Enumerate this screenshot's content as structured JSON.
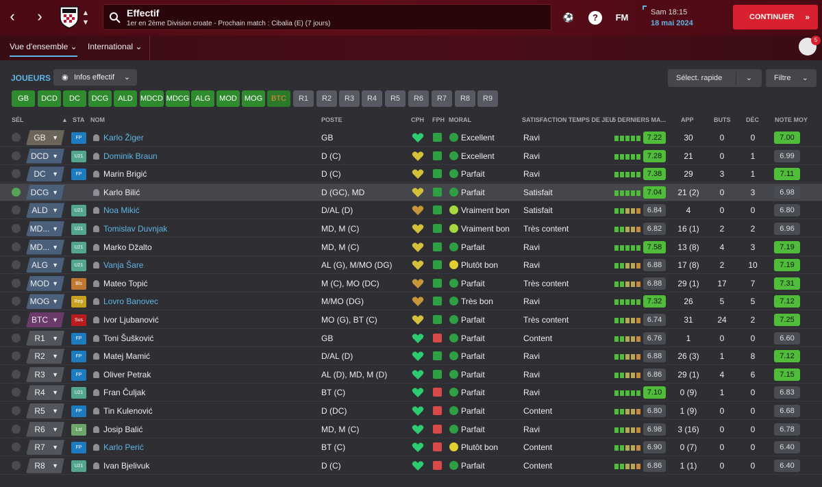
{
  "header": {
    "title": "Effectif",
    "subtitle": "1er en 2ème Division croate - Prochain match : Cibalia (E) (7 jours)",
    "fm_label": "FM",
    "time": "Sam 18:15",
    "date": "18 mai 2024",
    "continue_label": "CONTINUER",
    "inbox_count": "5"
  },
  "tabs": {
    "overview": "Vue d'ensemble",
    "international": "International"
  },
  "toolbar": {
    "players_label": "JOUEURS",
    "view_label": "Infos effectif",
    "quick_select": "Sélect. rapide",
    "filter": "Filtre"
  },
  "chips": [
    "GB",
    "DCD",
    "DC",
    "DCG",
    "ALD",
    "MDCD",
    "MDCG",
    "ALG",
    "MOD",
    "MOG",
    "BTC",
    "R1",
    "R2",
    "R3",
    "R4",
    "R5",
    "R6",
    "R7",
    "R8",
    "R9"
  ],
  "columns": {
    "sel": "SÉL",
    "sta": "STA",
    "name": "NOM",
    "pos": "POSTE",
    "cph": "CPH",
    "fph": "FPH",
    "moral": "MORAL",
    "sat": "SATISFACTION TEMPS DE JEU",
    "form": "5 DERNIERS MA...",
    "app": "APP",
    "buts": "BUTS",
    "dec": "DÉC",
    "note": "NOTE MOY"
  },
  "colors": {
    "accent": "#5fb5e6",
    "continue": "#d8202e",
    "good_rating": "#4fbd3a",
    "chip_green": "#2e8b2e",
    "chip_grey": "#575a62"
  },
  "players": [
    {
      "slot": "GB",
      "sta": "FP",
      "name": "Karlo Žiger",
      "pos": "GB",
      "moral": "Excellent",
      "sat": "Ravi",
      "form": "7.22",
      "app": "30",
      "buts": "0",
      "dec": "0",
      "note": "7.00"
    },
    {
      "slot": "DCD",
      "sta": "U21",
      "name": "Dominik Braun",
      "pos": "D (C)",
      "moral": "Excellent",
      "sat": "Ravi",
      "form": "7.28",
      "app": "21",
      "buts": "0",
      "dec": "1",
      "note": "6.99"
    },
    {
      "slot": "DC",
      "sta": "FP",
      "name": "Marin Brigić",
      "pos": "D (C)",
      "moral": "Parfait",
      "sat": "Ravi",
      "form": "7.38",
      "app": "29",
      "buts": "3",
      "dec": "1",
      "note": "7.11"
    },
    {
      "slot": "DCG",
      "sta": "",
      "name": "Karlo Bilić",
      "pos": "D (GC), MD",
      "moral": "Parfait",
      "sat": "Satisfait",
      "form": "7.04",
      "app": "21 (2)",
      "buts": "0",
      "dec": "3",
      "note": "6.98"
    },
    {
      "slot": "ALD",
      "sta": "U21",
      "name": "Noa Mikić",
      "pos": "D/AL (D)",
      "moral": "Vraiment bon",
      "sat": "Satisfait",
      "form": "6.84",
      "app": "4",
      "buts": "0",
      "dec": "0",
      "note": "6.80"
    },
    {
      "slot": "MD...",
      "sta": "U21",
      "name": "Tomislav Duvnjak",
      "pos": "MD, M (C)",
      "moral": "Vraiment bon",
      "sat": "Très content",
      "form": "6.82",
      "app": "16 (1)",
      "buts": "2",
      "dec": "2",
      "note": "6.96"
    },
    {
      "slot": "MD...",
      "sta": "U21",
      "name": "Marko Džalto",
      "pos": "MD, M (C)",
      "moral": "Parfait",
      "sat": "Ravi",
      "form": "7.58",
      "app": "13 (8)",
      "buts": "4",
      "dec": "3",
      "note": "7.19"
    },
    {
      "slot": "ALG",
      "sta": "U21",
      "name": "Vanja Šare",
      "pos": "AL (G), M/MO (DG)",
      "moral": "Plutôt bon",
      "sat": "Ravi",
      "form": "6.88",
      "app": "17 (8)",
      "buts": "2",
      "dec": "10",
      "note": "7.19"
    },
    {
      "slot": "MOD",
      "sta": "Bls",
      "name": "Mateo Topić",
      "pos": "M (C), MO (DC)",
      "moral": "Parfait",
      "sat": "Très content",
      "form": "6.88",
      "app": "29 (1)",
      "buts": "17",
      "dec": "7",
      "note": "7.31"
    },
    {
      "slot": "MOG",
      "sta": "Rep",
      "name": "Lovro Banovec",
      "pos": "M/MO (DG)",
      "moral": "Très bon",
      "sat": "Ravi",
      "form": "7.32",
      "app": "26",
      "buts": "5",
      "dec": "5",
      "note": "7.12"
    },
    {
      "slot": "BTC",
      "sta": "Sus",
      "name": "Ivor Ljubanović",
      "pos": "MO (G), BT (C)",
      "moral": "Parfait",
      "sat": "Très content",
      "form": "6.74",
      "app": "31",
      "buts": "24",
      "dec": "2",
      "note": "7.25"
    },
    {
      "slot": "R1",
      "sta": "FP",
      "name": "Toni Šušković",
      "pos": "GB",
      "moral": "Parfait",
      "sat": "Content",
      "form": "6.76",
      "app": "1",
      "buts": "0",
      "dec": "0",
      "note": "6.60"
    },
    {
      "slot": "R2",
      "sta": "FP",
      "name": "Matej Mamić",
      "pos": "D/AL (D)",
      "moral": "Parfait",
      "sat": "Ravi",
      "form": "6.88",
      "app": "26 (3)",
      "buts": "1",
      "dec": "8",
      "note": "7.12"
    },
    {
      "slot": "R3",
      "sta": "FP",
      "name": "Oliver Petrak",
      "pos": "AL (D), MD, M (D)",
      "moral": "Parfait",
      "sat": "Ravi",
      "form": "6.86",
      "app": "29 (1)",
      "buts": "4",
      "dec": "6",
      "note": "7.15"
    },
    {
      "slot": "R4",
      "sta": "U21",
      "name": "Fran Čuljak",
      "pos": "BT (C)",
      "moral": "Parfait",
      "sat": "Ravi",
      "form": "7.10",
      "app": "0 (9)",
      "buts": "1",
      "dec": "0",
      "note": "6.83"
    },
    {
      "slot": "R5",
      "sta": "FP",
      "name": "Tin Kulenović",
      "pos": "D (DC)",
      "moral": "Parfait",
      "sat": "Content",
      "form": "6.80",
      "app": "1 (9)",
      "buts": "0",
      "dec": "0",
      "note": "6.68"
    },
    {
      "slot": "R6",
      "sta": "Lst",
      "name": "Josip Balić",
      "pos": "MD, M (C)",
      "moral": "Parfait",
      "sat": "Ravi",
      "form": "6.98",
      "app": "3 (16)",
      "buts": "0",
      "dec": "0",
      "note": "6.78"
    },
    {
      "slot": "R7",
      "sta": "FP",
      "name": "Karlo Perić",
      "pos": "BT (C)",
      "moral": "Plutôt bon",
      "sat": "Content",
      "form": "6.90",
      "app": "0 (7)",
      "buts": "0",
      "dec": "0",
      "note": "6.40"
    },
    {
      "slot": "R8",
      "sta": "U21",
      "name": "Ivan Bjelivuk",
      "pos": "D (C)",
      "moral": "Parfait",
      "sat": "Content",
      "form": "6.86",
      "app": "1 (1)",
      "buts": "0",
      "dec": "0",
      "note": "6.40"
    }
  ]
}
